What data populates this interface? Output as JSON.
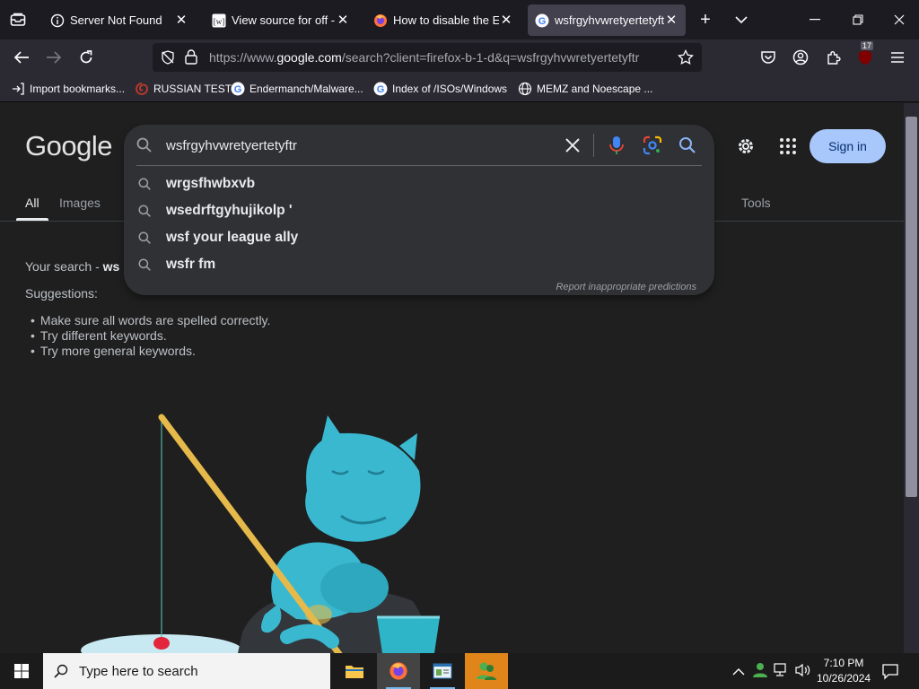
{
  "browser": {
    "tabs": [
      {
        "title": "Server Not Found",
        "icon": "info-icon"
      },
      {
        "title": "View source for off - Wi",
        "icon": "wikipedia-icon"
      },
      {
        "title": "How to disable the Ente",
        "icon": "firefox-icon"
      },
      {
        "title": "wsfrgyhvwretyertetyftr",
        "icon": "google-icon",
        "active": true
      }
    ],
    "url": {
      "prefix": "https://www.",
      "host": "google.com",
      "path": "/search?client=firefox-b-1-d&q=wsfrgyhvwretyertetyftr"
    },
    "extension_badge": "17",
    "bookmarks": [
      {
        "label": "Import bookmarks...",
        "icon": "import-icon"
      },
      {
        "label": "RUSSIAN TEST",
        "icon": "swirl-icon"
      },
      {
        "label": "Endermanch/Malware...",
        "icon": "google-icon"
      },
      {
        "label": "Index of /ISOs/Windows",
        "icon": "google-icon"
      },
      {
        "label": "MEMZ and Noescape ...",
        "icon": "globe-icon"
      }
    ]
  },
  "google": {
    "logo": "Google",
    "query": "wsfrgyhvwretyertetyftr",
    "suggestions": [
      "wrgsfhwbxvb",
      "wsedrftgyhujikolp '",
      "wsf your league ally",
      "wsfr fm"
    ],
    "report": "Report inappropriate predictions",
    "signin": "Sign in",
    "tabs": [
      "All",
      "Images"
    ],
    "tools": "Tools",
    "results": {
      "your_search": "Your search - ",
      "your_search_bold": "ws",
      "suggestions_label": "Suggestions:",
      "tips": [
        "Make sure all words are spelled correctly.",
        "Try different keywords.",
        "Try more general keywords."
      ]
    },
    "colors": {
      "accent_blue": "#a8c7fa",
      "background": "#1f1f1f",
      "searchbox": "#303134"
    }
  },
  "taskbar": {
    "search_placeholder": "Type here to search",
    "time": "7:10 PM",
    "date": "10/26/2024"
  }
}
